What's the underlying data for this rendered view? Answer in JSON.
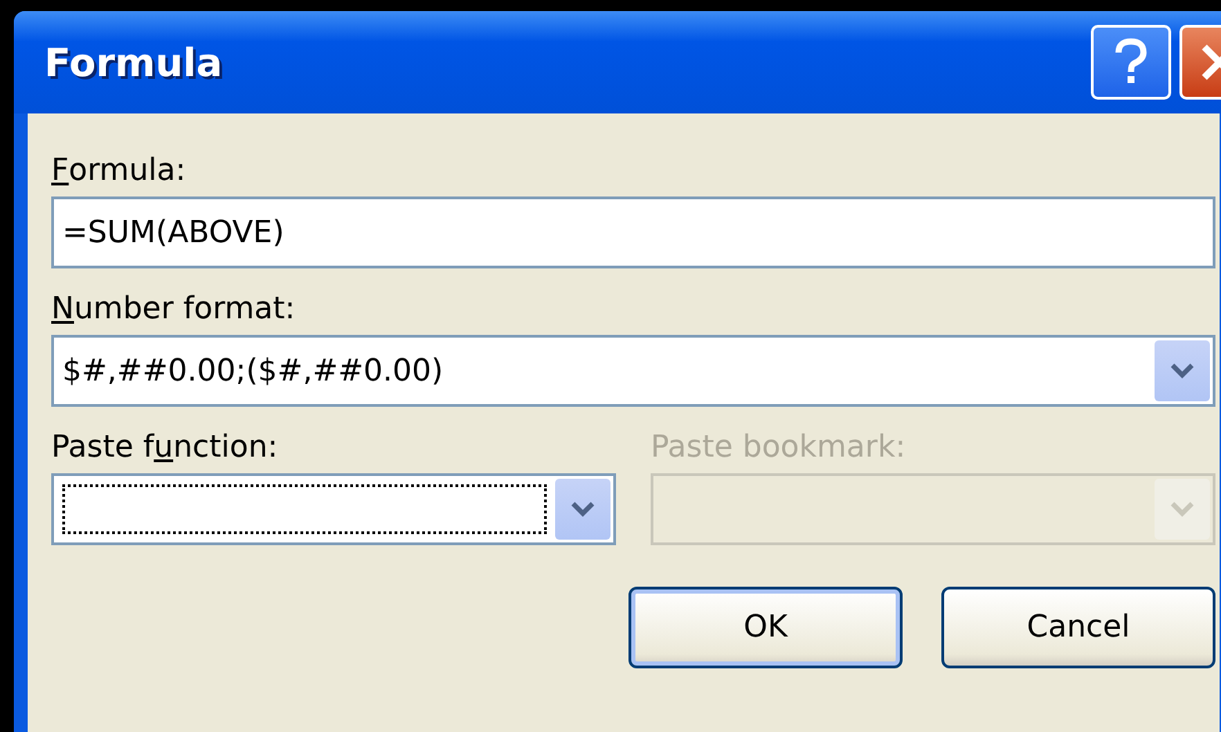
{
  "window": {
    "title": "Formula"
  },
  "formula": {
    "label": {
      "access_key": "F",
      "after": "ormula:"
    },
    "value": "=SUM(ABOVE)"
  },
  "number_format": {
    "label": {
      "access_key": "N",
      "after": "umber format:"
    },
    "value": "$#,##0.00;($#,##0.00)",
    "disabled": false
  },
  "paste_function": {
    "label": {
      "before": "Paste f",
      "access_key": "u",
      "after": "nction:"
    },
    "disabled": false,
    "focused": true
  },
  "paste_bookmark": {
    "label": {
      "before": "Paste bookmark:"
    },
    "disabled": true,
    "focused": false
  },
  "buttons": [
    {
      "label": "OK",
      "default": true
    },
    {
      "label": "Cancel",
      "default": false
    }
  ]
}
